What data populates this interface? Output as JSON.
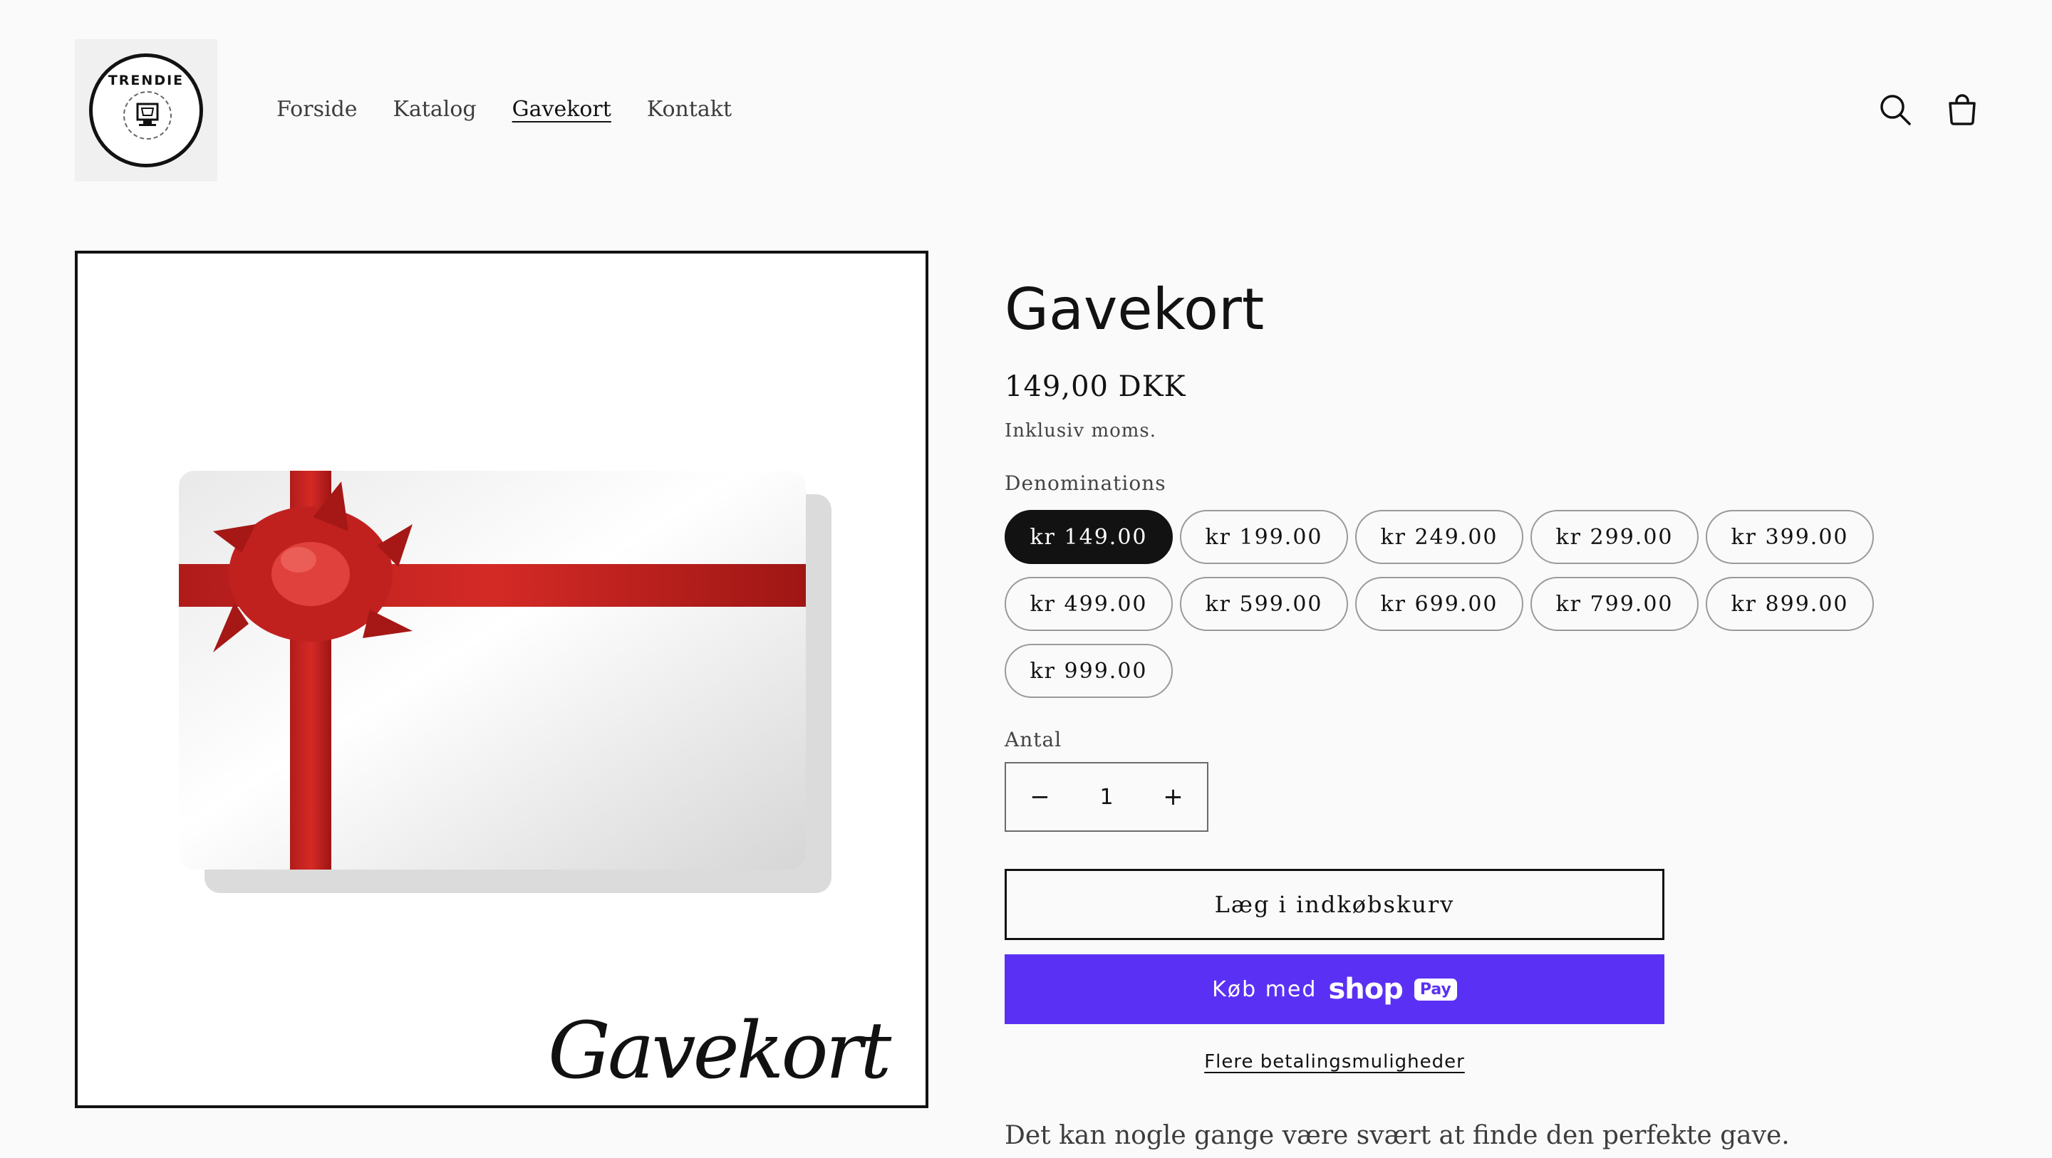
{
  "header": {
    "logo_text": "TRENDIE",
    "nav": [
      {
        "label": "Forside",
        "active": false
      },
      {
        "label": "Katalog",
        "active": false
      },
      {
        "label": "Gavekort",
        "active": true
      },
      {
        "label": "Kontakt",
        "active": false
      }
    ],
    "icons": {
      "search": "search-icon",
      "cart": "cart-icon"
    }
  },
  "media": {
    "card_caption": "Gavekort",
    "ribbon_color": "#c0211f"
  },
  "product": {
    "title": "Gavekort",
    "price": "149,00 DKK",
    "tax_note": "Inklusiv moms.",
    "variant_legend": "Denominations",
    "variants": [
      {
        "label": "kr 149.00",
        "selected": true
      },
      {
        "label": "kr 199.00",
        "selected": false
      },
      {
        "label": "kr 249.00",
        "selected": false
      },
      {
        "label": "kr 299.00",
        "selected": false
      },
      {
        "label": "kr 399.00",
        "selected": false
      },
      {
        "label": "kr 499.00",
        "selected": false
      },
      {
        "label": "kr 599.00",
        "selected": false
      },
      {
        "label": "kr 699.00",
        "selected": false
      },
      {
        "label": "kr 799.00",
        "selected": false
      },
      {
        "label": "kr 899.00",
        "selected": false
      },
      {
        "label": "kr 999.00",
        "selected": false
      }
    ],
    "quantity_label": "Antal",
    "quantity_value": "1",
    "quantity_minus": "−",
    "quantity_plus": "+",
    "add_to_cart": "Læg i indkøbskurv",
    "shop_pay_prefix": "Køb med",
    "shop_pay_logo": "shop",
    "shop_pay_badge": "Pay",
    "shop_pay_color": "#5a31f4",
    "more_payment_options": "Flere betalingsmuligheder",
    "description": "Det kan nogle gange være svært at finde den perfekte gave."
  }
}
